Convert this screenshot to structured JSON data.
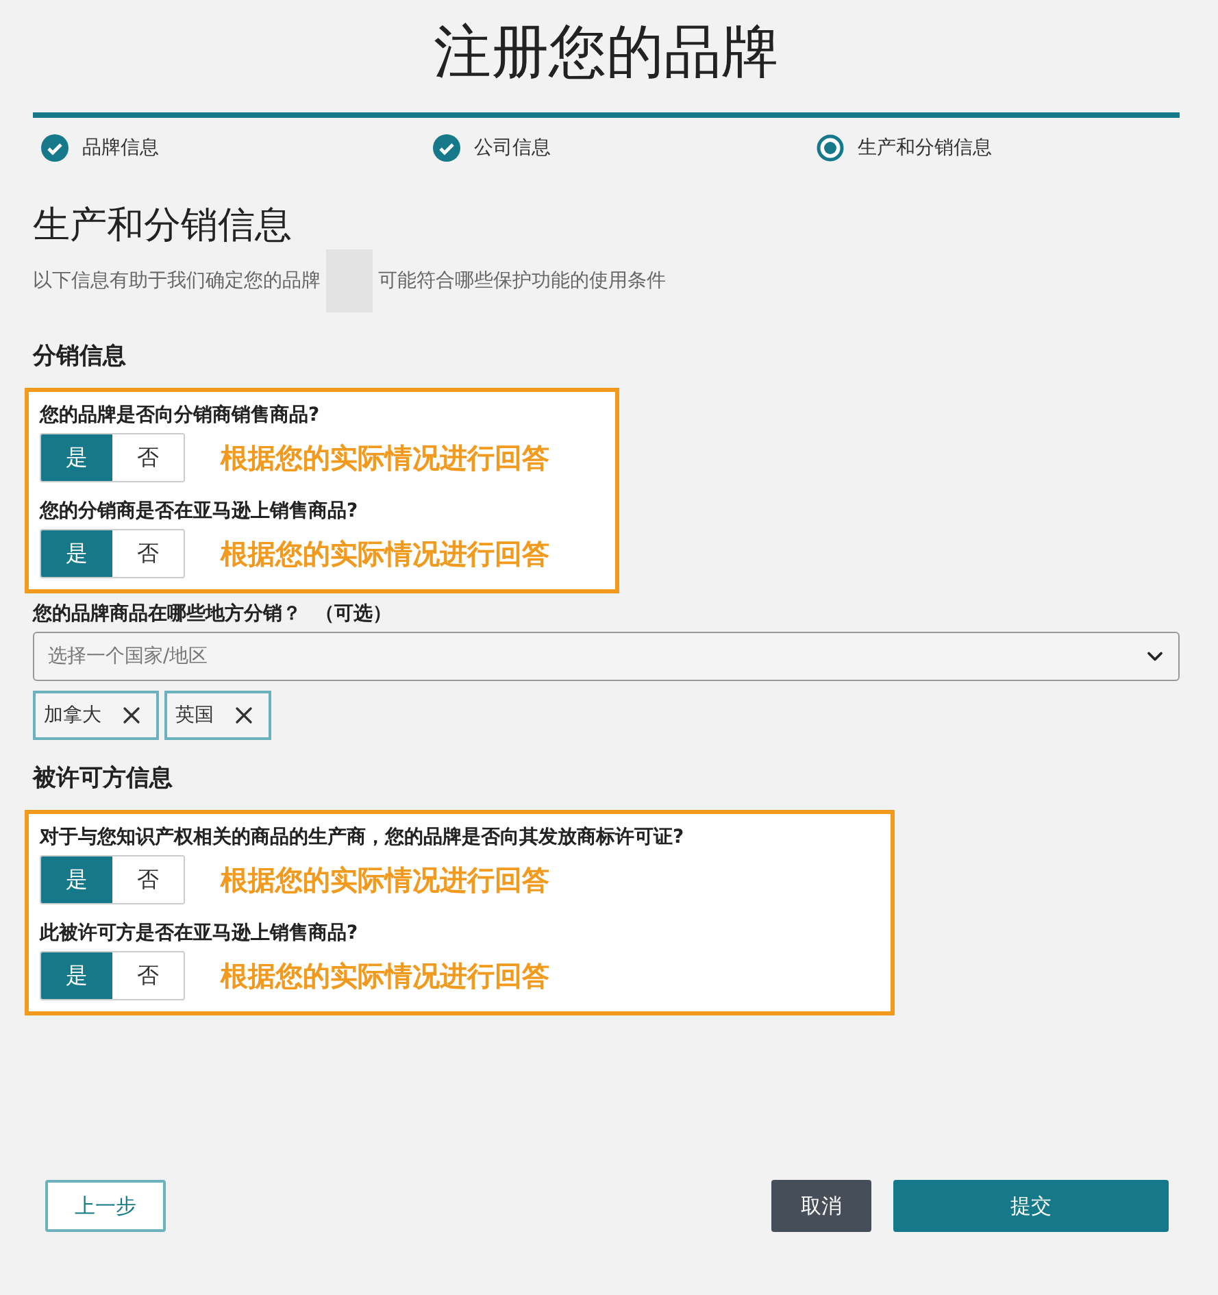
{
  "title": "注册您的品牌",
  "steps": [
    {
      "label": "品牌信息",
      "completed": true,
      "selected": false
    },
    {
      "label": "公司信息",
      "completed": true,
      "selected": false
    },
    {
      "label": "生产和分销信息",
      "completed": false,
      "selected": true
    }
  ],
  "section": {
    "heading": "生产和分销信息",
    "subtitle_before": "以下信息有助于我们确定您的品牌",
    "subtitle_after": "可能符合哪些保护功能的使用条件"
  },
  "distribution": {
    "heading": "分销信息",
    "questions": [
      {
        "text": "您的品牌是否向分销商销售商品?",
        "options": [
          {
            "label": "是",
            "selected": true
          },
          {
            "label": "否",
            "selected": false
          }
        ],
        "note": "根据您的实际情况进行回答"
      },
      {
        "text": "您的分销商是否在亚马逊上销售商品?",
        "options": [
          {
            "label": "是",
            "selected": true
          },
          {
            "label": "否",
            "selected": false
          }
        ],
        "note": "根据您的实际情况进行回答"
      }
    ],
    "region_field": {
      "label": "您的品牌商品在哪些地方分销？",
      "optional": "（可选）",
      "placeholder": "选择一个国家/地区"
    },
    "chips": [
      {
        "label": "加拿大"
      },
      {
        "label": "英国"
      }
    ]
  },
  "licensee": {
    "heading": "被许可方信息",
    "questions": [
      {
        "text": "对于与您知识产权相关的商品的生产商，您的品牌是否向其发放商标许可证?",
        "options": [
          {
            "label": "是",
            "selected": true
          },
          {
            "label": "否",
            "selected": false
          }
        ],
        "note": "根据您的实际情况进行回答"
      },
      {
        "text": "此被许可方是否在亚马逊上销售商品?",
        "options": [
          {
            "label": "是",
            "selected": true
          },
          {
            "label": "否",
            "selected": false
          }
        ],
        "note": "根据您的实际情况进行回答"
      }
    ]
  },
  "buttons": [
    {
      "label": "上一步",
      "kind": "back"
    },
    {
      "label": "取消",
      "kind": "cancel"
    },
    {
      "label": "提交",
      "kind": "submit"
    }
  ]
}
